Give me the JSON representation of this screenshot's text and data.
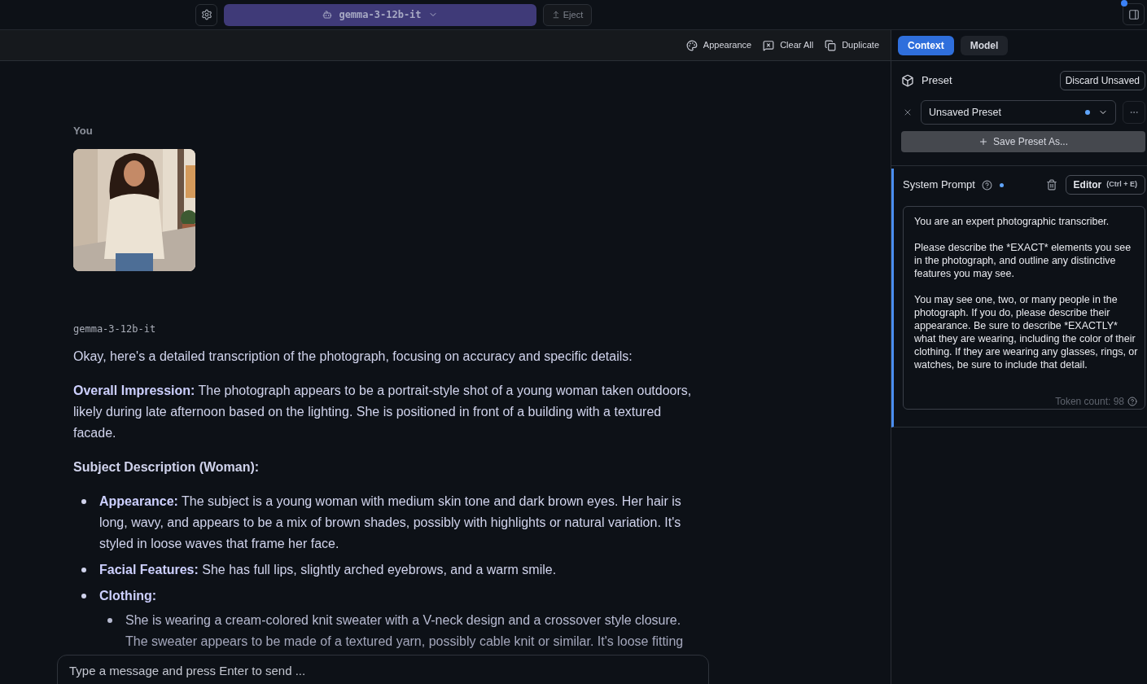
{
  "top_bar": {
    "model_selector": {
      "label": "gemma-3-12b-it"
    },
    "eject_button": "Eject"
  },
  "toolbar": [
    {
      "kind": "palette",
      "label": "Appearance"
    },
    {
      "kind": "clear",
      "label": "Clear All"
    },
    {
      "kind": "duplicate",
      "label": "Duplicate"
    }
  ],
  "chat": {
    "user": {
      "sender": "You"
    },
    "assistant": {
      "sender": "gemma-3-12b-it",
      "blocks": [
        {
          "kind": "paragraph",
          "text": "Okay, here's a detailed transcription of the photograph, focusing on accuracy and specific details:"
        },
        {
          "kind": "paragraph",
          "text": "**Overall Impression:** The photograph appears to be a portrait-style shot of a young woman taken outdoors, likely during late afternoon based on the lighting. She is positioned in front of a building with a textured facade."
        },
        {
          "kind": "heading",
          "text": "Subject Description (Woman):"
        },
        {
          "kind": "list",
          "items": [
            {
              "text": "**Appearance:** The subject is a young woman with medium skin tone and dark brown eyes. Her hair is long, wavy, and appears to be a mix of brown shades, possibly with highlights or natural variation. It's styled in loose waves that frame her face."
            },
            {
              "text": "**Facial Features:** She has full lips, slightly arched eyebrows, and a warm smile."
            },
            {
              "text": "**Clothing:**",
              "children": [
                {
                  "text": "She is wearing a cream-colored knit sweater with a V-neck design and a crossover style closure. The sweater appears to be made of a textured yarn, possibly cable knit or similar. It's loose fitting"
                }
              ]
            }
          ]
        }
      ]
    }
  },
  "composer": {
    "placeholder": "Type a message and press Enter to send ..."
  },
  "side_panel": {
    "tabs": [
      {
        "label": "Context",
        "selected": true
      },
      {
        "label": "Model",
        "selected": false
      }
    ],
    "preset": {
      "title": "Preset",
      "discard_button": "Discard Unsaved",
      "selected_preset": "Unsaved Preset",
      "unsaved": true,
      "save_button": "Save Preset As..."
    },
    "system_prompt": {
      "title": "System Prompt",
      "unsaved": true,
      "focused": true,
      "editor_button": "Editor",
      "shortcut": "(Ctrl + E)",
      "value": "You are an expert photographic transcriber.\n\nPlease describe the *EXACT* elements you see in the photograph, and outline any distinctive features you may see.\n\nYou may see one, two, or many people in the photograph. If you do, please describe their appearance. Be sure to describe *EXACTLY* what they are wearing, including the color of their clothing. If they are wearing any glasses, rings, or watches, be sure to include that detail.",
      "token_count": "Token count: 98"
    }
  }
}
